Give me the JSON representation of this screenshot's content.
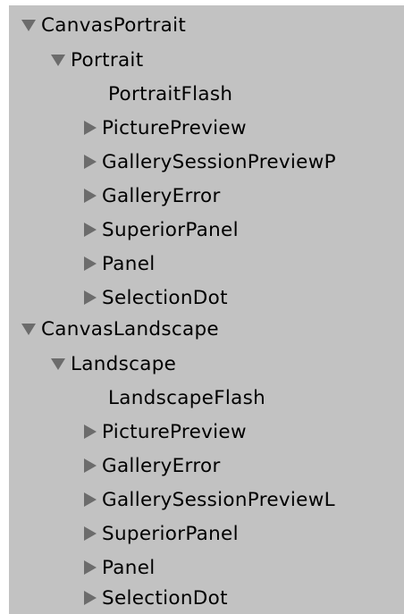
{
  "hierarchy": {
    "items": [
      {
        "label": "CanvasPortrait",
        "depth": 0,
        "state": "expanded",
        "icon": "triangle-down-icon"
      },
      {
        "label": "Portrait",
        "depth": 1,
        "state": "expanded",
        "icon": "triangle-down-icon"
      },
      {
        "label": "PortraitFlash",
        "depth": 2,
        "state": "none",
        "icon": ""
      },
      {
        "label": "PicturePreview",
        "depth": 2,
        "state": "collapsed",
        "icon": "triangle-right-icon"
      },
      {
        "label": "GallerySessionPreviewP",
        "depth": 2,
        "state": "collapsed",
        "icon": "triangle-right-icon"
      },
      {
        "label": "GalleryError",
        "depth": 2,
        "state": "collapsed",
        "icon": "triangle-right-icon"
      },
      {
        "label": "SuperiorPanel",
        "depth": 2,
        "state": "collapsed",
        "icon": "triangle-right-icon"
      },
      {
        "label": "Panel",
        "depth": 2,
        "state": "collapsed",
        "icon": "triangle-right-icon"
      },
      {
        "label": "SelectionDot",
        "depth": 2,
        "state": "collapsed",
        "icon": "triangle-right-icon"
      },
      {
        "label": "CanvasLandscape",
        "depth": 0,
        "state": "expanded",
        "icon": "triangle-down-icon"
      },
      {
        "label": "Landscape",
        "depth": 1,
        "state": "expanded",
        "icon": "triangle-down-icon"
      },
      {
        "label": "LandscapeFlash",
        "depth": 2,
        "state": "none",
        "icon": ""
      },
      {
        "label": "PicturePreview",
        "depth": 2,
        "state": "collapsed",
        "icon": "triangle-right-icon"
      },
      {
        "label": "GalleryError",
        "depth": 2,
        "state": "collapsed",
        "icon": "triangle-right-icon"
      },
      {
        "label": "GallerySessionPreviewL",
        "depth": 2,
        "state": "collapsed",
        "icon": "triangle-right-icon"
      },
      {
        "label": "SuperiorPanel",
        "depth": 2,
        "state": "collapsed",
        "icon": "triangle-right-icon"
      },
      {
        "label": "Panel",
        "depth": 2,
        "state": "collapsed",
        "icon": "triangle-right-icon"
      },
      {
        "label": "SelectionDot",
        "depth": 2,
        "state": "collapsed",
        "icon": "triangle-right-icon"
      }
    ]
  },
  "colors": {
    "panel_background": "#c2c2c2",
    "arrow": "#6c6c6c",
    "text": "#000000"
  }
}
